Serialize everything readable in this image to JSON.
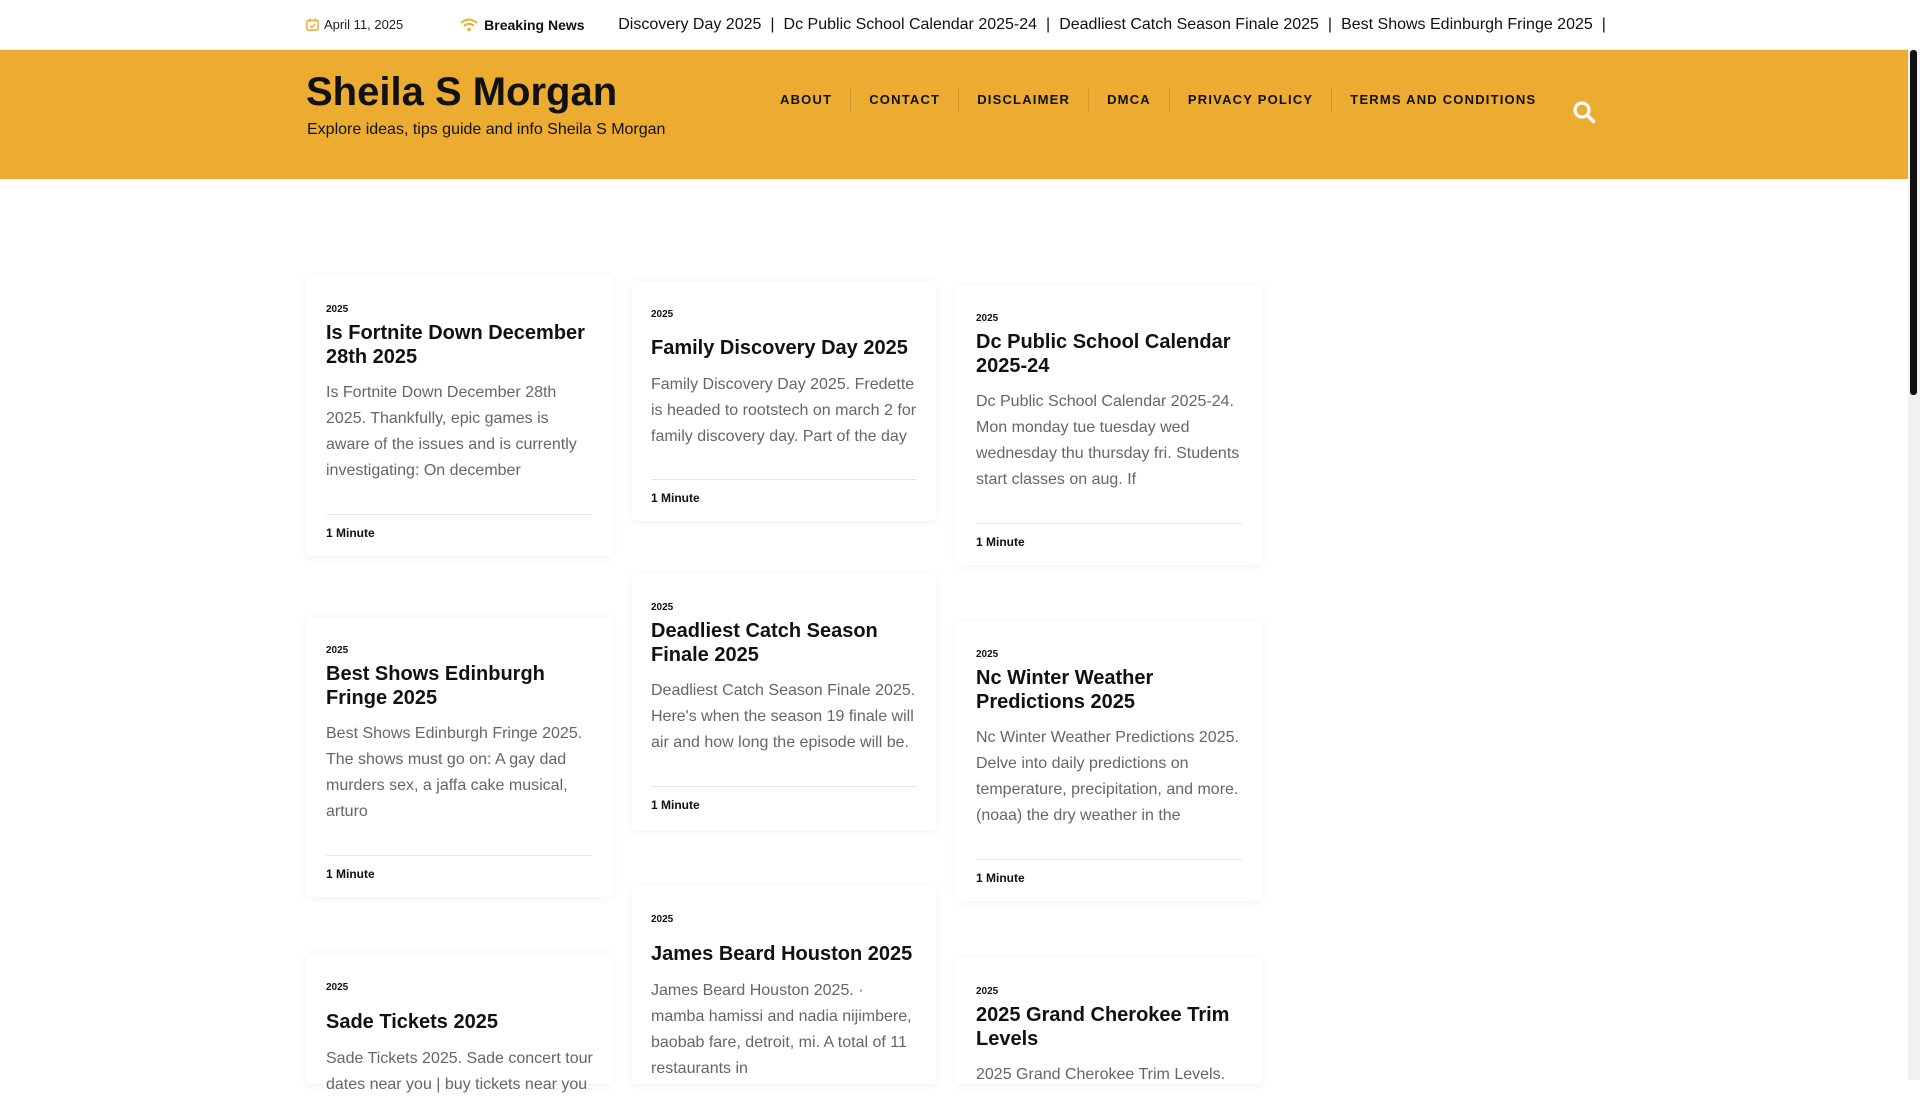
{
  "topbar": {
    "date": "April 11, 2025",
    "breaking_label": "Breaking News",
    "ticker": [
      "Discovery Day 2025",
      "Dc Public School Calendar 2025-24",
      "Deadliest Catch Season Finale 2025",
      "Best Shows Edinburgh Fringe 2025"
    ],
    "separator": "|"
  },
  "header": {
    "site_title": "Sheila S Morgan",
    "tagline": "Explore ideas, tips guide and info Sheila S Morgan",
    "nav": [
      "ABOUT",
      "CONTACT",
      "DISCLAIMER",
      "DMCA",
      "PRIVACY POLICY",
      "TERMS AND CONDITIONS"
    ],
    "search_icon": "search-icon",
    "accent_color": "#ecac32"
  },
  "posts": [
    {
      "category": "2025",
      "title": "Is Fortnite Down December 28th 2025",
      "excerpt": "Is Fortnite Down December 28th 2025. Thankfully, epic games is aware of the issues and is currently investigating: On december",
      "read_time": "1 Minute"
    },
    {
      "category": "2025",
      "title": "Family Discovery Day 2025",
      "excerpt": "Family Discovery Day 2025. Fredette is headed to rootstech on march 2 for family discovery day. Part of the day",
      "read_time": "1 Minute"
    },
    {
      "category": "2025",
      "title": "Dc Public School Calendar 2025-24",
      "excerpt": "Dc Public School Calendar 2025-24. Mon monday tue tuesday wed wednesday thu thursday fri. Students start classes on aug. If",
      "read_time": "1 Minute"
    },
    {
      "category": "2025",
      "title": "Best Shows Edinburgh Fringe 2025",
      "excerpt": "Best Shows Edinburgh Fringe 2025. The shows must go on: A gay dad murders sex, a jaffa cake musical, arturo",
      "read_time": "1 Minute"
    },
    {
      "category": "2025",
      "title": "Deadliest Catch Season Finale 2025",
      "excerpt": "Deadliest Catch Season Finale 2025. Here's when the season 19 finale will air and how long the episode will be.",
      "read_time": "1 Minute"
    },
    {
      "category": "2025",
      "title": "Nc Winter Weather Predictions 2025",
      "excerpt": "Nc Winter Weather Predictions 2025. Delve into daily predictions on temperature, precipitation, and more. (noaa) the dry weather in the",
      "read_time": "1 Minute"
    },
    {
      "category": "2025",
      "title": "Sade Tickets 2025",
      "excerpt": "Sade Tickets 2025. Sade concert tour dates near you | buy tickets near you",
      "read_time": ""
    },
    {
      "category": "2025",
      "title": "James Beard Houston 2025",
      "excerpt": "James Beard Houston 2025. · mamba hamissi and nadia nijimbere, baobab fare, detroit, mi. A total of 11 restaurants in",
      "read_time": ""
    },
    {
      "category": "2025",
      "title": "2025 Grand Cherokee Trim Levels",
      "excerpt": "2025 Grand Cherokee Trim Levels.",
      "read_time": ""
    }
  ]
}
